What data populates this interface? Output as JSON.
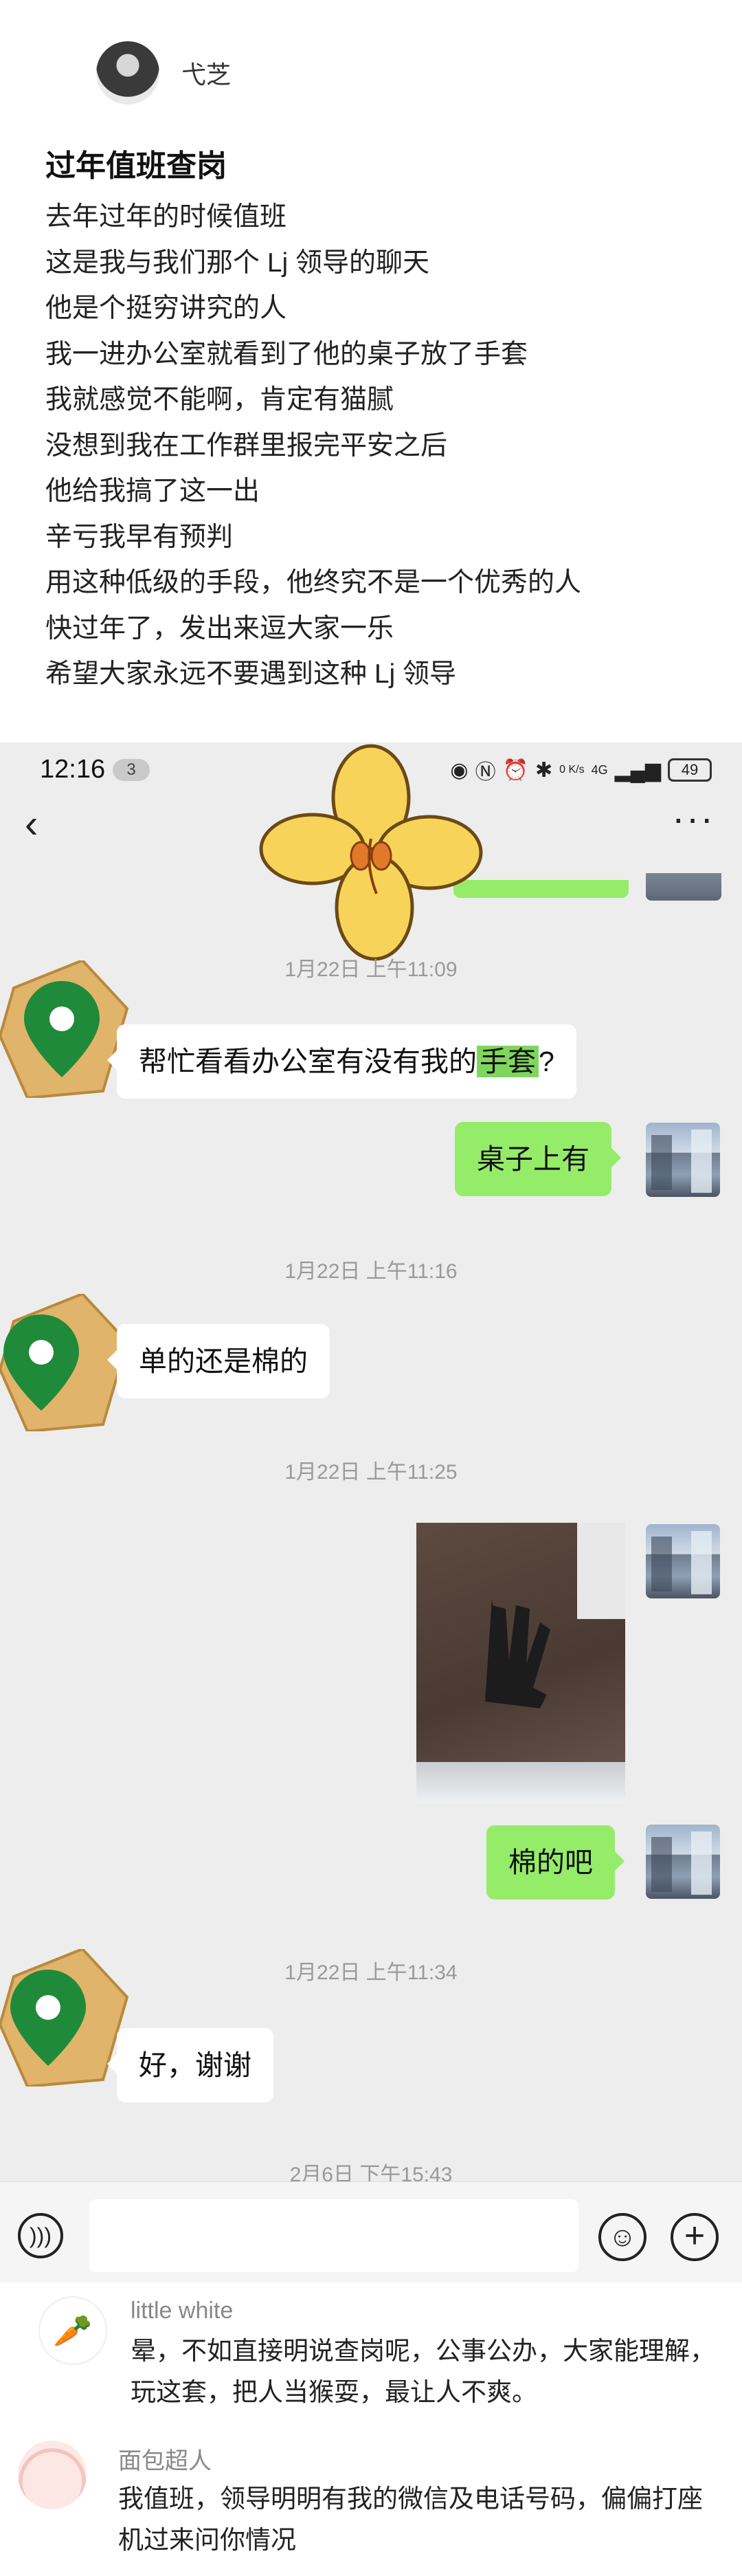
{
  "post": {
    "author": "弋芝",
    "title": "过年值班查岗",
    "lines": [
      "去年过年的时候值班",
      "这是我与我们那个 Lj 领导的聊天",
      "他是个挺穷讲究的人",
      "我一进办公室就看到了他的桌子放了手套",
      "我就感觉不能啊，肯定有猫腻",
      "没想到我在工作群里报完平安之后",
      "他给我搞了这一出",
      "辛亏我早有预判",
      "用这种低级的手段，他终究不是一个优秀的人",
      "快过年了，发出来逗大家一乐",
      "希望大家永远不要遇到这种 Lj 领导"
    ]
  },
  "status_bar": {
    "time": "12:16",
    "notification_count": "3",
    "network_speed": "0 K/s",
    "signal": "4G",
    "battery": "49"
  },
  "chat": {
    "messages": [
      {
        "timestamp": "1月22日 上午11:09"
      },
      {
        "sender": "other",
        "text_before": "帮忙看看办公室有没有我的",
        "highlight": "手套",
        "text_after": "?"
      },
      {
        "sender": "self",
        "text": "桌子上有"
      },
      {
        "timestamp": "1月22日 上午11:16"
      },
      {
        "sender": "other",
        "text": "单的还是棉的"
      },
      {
        "timestamp": "1月22日 上午11:25"
      },
      {
        "sender": "self",
        "type": "image",
        "description": "glove photo"
      },
      {
        "sender": "self",
        "text": "棉的吧"
      },
      {
        "timestamp": "1月22日 上午11:34"
      },
      {
        "sender": "other",
        "text": "好，谢谢"
      },
      {
        "timestamp": "2月6日 下午15:43"
      }
    ]
  },
  "comments": [
    {
      "user": "little white",
      "avatar_icon": "carrot-icon",
      "text": "晕，不如直接明说查岗呢，公事公办，大家能理解，玩这套，把人当猴耍，最让人不爽。"
    },
    {
      "user": "面包超人",
      "avatar_icon": "bunny-avatar",
      "text": "我值班，领导明明有我的微信及电话号码，偏偏打座机过来问你情况"
    }
  ],
  "colors": {
    "chat_bg": "#ededed",
    "self_bubble": "#95ec69",
    "other_bubble": "#ffffff",
    "highlight": "#7fd65c",
    "pin_green": "#1f8a3a",
    "pin_frame": "#e0b46a",
    "sticker_yellow": "#f8d35a"
  }
}
